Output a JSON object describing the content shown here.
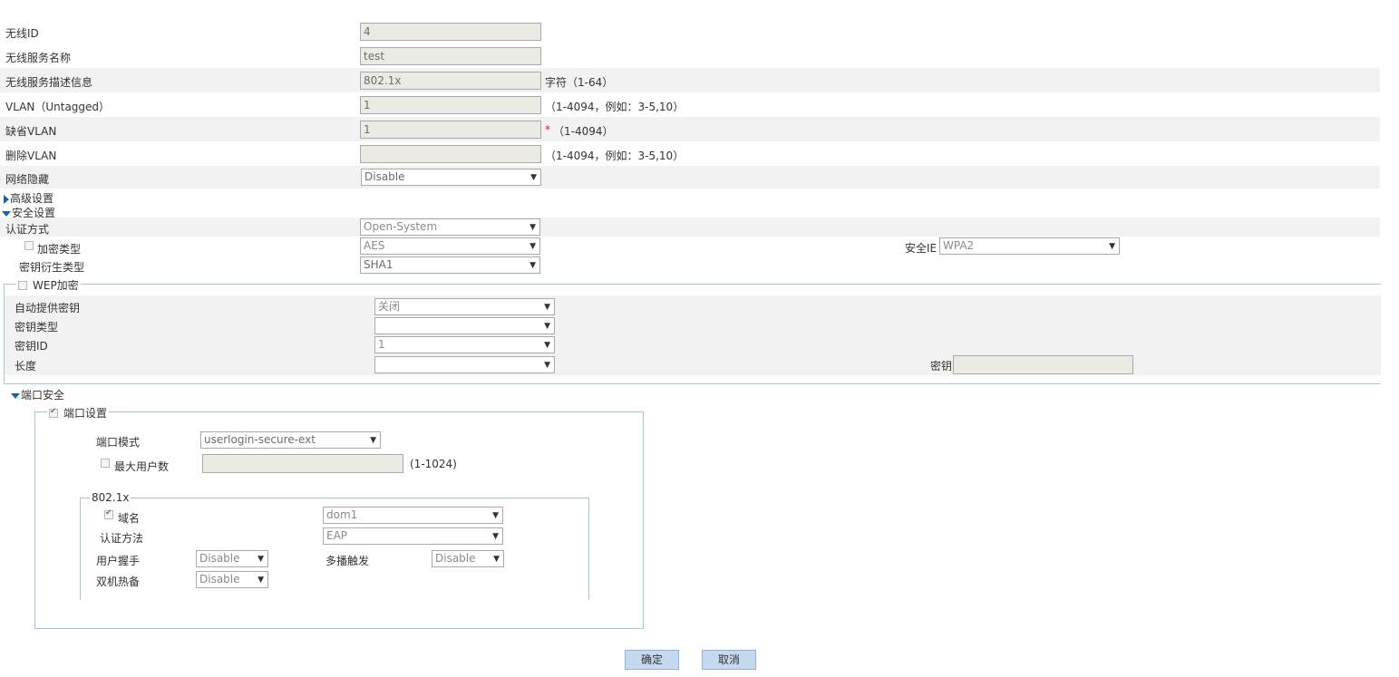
{
  "basic": {
    "wireless_id_label": "无线ID",
    "wireless_id_value": "4",
    "service_name_label": "无线服务名称",
    "service_name_value": "test",
    "service_desc_label": "无线服务描述信息",
    "service_desc_value": "802.1x",
    "service_desc_hint": "字符（1-64）",
    "vlan_untagged_label": "VLAN（Untagged）",
    "vlan_untagged_value": "1",
    "vlan_untagged_hint": "（1-4094，例如：3-5,10）",
    "default_vlan_label": "缺省VLAN",
    "default_vlan_value": "1",
    "default_vlan_star": "*",
    "default_vlan_hint": "（1-4094）",
    "delete_vlan_label": "删除VLAN",
    "delete_vlan_value": "",
    "delete_vlan_hint": "（1-4094，例如：3-5,10）",
    "hide_network_label": "网络隐藏",
    "hide_network_value": "Disable"
  },
  "sections": {
    "advanced": "高级设置",
    "security": "安全设置",
    "port_security": "端口安全"
  },
  "security": {
    "auth_method_label": "认证方式",
    "auth_method_value": "Open-System",
    "cipher_type_label": "加密类型",
    "cipher_type_value": "AES",
    "security_ie_label": "安全IE",
    "security_ie_value": "WPA2",
    "key_derivation_label": "密钥衍生类型",
    "key_derivation_value": "SHA1"
  },
  "wep": {
    "legend": "WEP加密",
    "auto_key_label": "自动提供密钥",
    "auto_key_value": "关闭",
    "key_type_label": "密钥类型",
    "key_type_value": "",
    "key_id_label": "密钥ID",
    "key_id_value": "1",
    "length_label": "长度",
    "length_value": "",
    "key_label": "密钥",
    "key_value": ""
  },
  "port": {
    "legend": "端口设置",
    "mode_label": "端口模式",
    "mode_value": "userlogin-secure-ext",
    "max_users_label": "最大用户数",
    "max_users_value": "",
    "max_users_hint": "(1-1024)",
    "dot1x_legend": "802.1x",
    "domain_label": "域名",
    "domain_value": "dom1",
    "auth_method_label": "认证方法",
    "auth_method_value": "EAP",
    "handshake_label": "用户握手",
    "handshake_value": "Disable",
    "multicast_label": "多播触发",
    "multicast_value": "Disable",
    "hot_backup_label": "双机热备",
    "hot_backup_value": "Disable"
  },
  "buttons": {
    "ok": "确定",
    "cancel": "取消"
  }
}
